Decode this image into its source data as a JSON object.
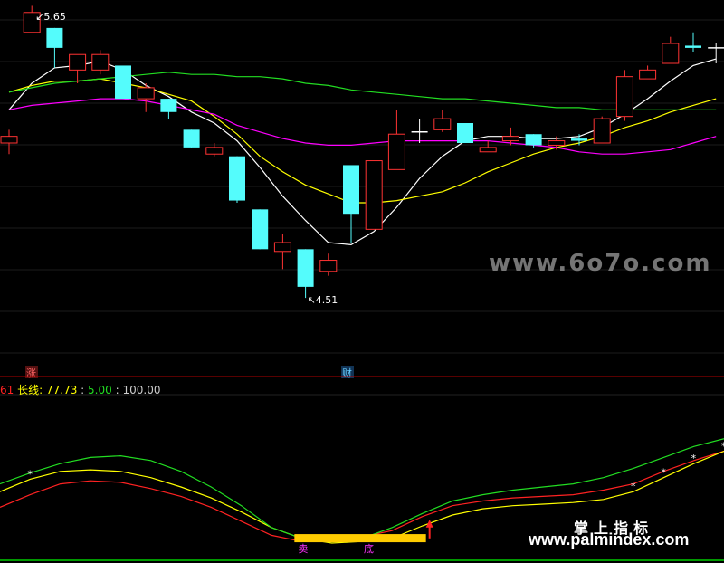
{
  "chart_data": [
    {
      "type": "candlestick",
      "price_range": [
        4.12,
        5.74
      ],
      "candles": [
        {
          "o": 5.11,
          "c": 5.14,
          "h": 5.17,
          "l": 5.06,
          "color": "red"
        },
        {
          "o": 5.61,
          "c": 5.7,
          "h": 5.73,
          "l": 5.61,
          "color": "red"
        },
        {
          "o": 5.63,
          "c": 5.54,
          "h": 5.63,
          "l": 5.45,
          "color": "cyan"
        },
        {
          "o": 5.44,
          "c": 5.51,
          "h": 5.51,
          "l": 5.38,
          "color": "red"
        },
        {
          "o": 5.44,
          "c": 5.51,
          "h": 5.53,
          "l": 5.42,
          "color": "red"
        },
        {
          "o": 5.46,
          "c": 5.31,
          "h": 5.46,
          "l": 5.31,
          "color": "cyan"
        },
        {
          "o": 5.31,
          "c": 5.36,
          "h": 5.38,
          "l": 5.25,
          "color": "red"
        },
        {
          "o": 5.31,
          "c": 5.25,
          "h": 5.31,
          "l": 5.22,
          "color": "cyan"
        },
        {
          "o": 5.17,
          "c": 5.09,
          "h": 5.17,
          "l": 5.09,
          "color": "cyan"
        },
        {
          "o": 5.06,
          "c": 5.09,
          "h": 5.11,
          "l": 5.05,
          "color": "red"
        },
        {
          "o": 5.05,
          "c": 4.85,
          "h": 5.05,
          "l": 4.84,
          "color": "cyan"
        },
        {
          "o": 4.81,
          "c": 4.63,
          "h": 4.81,
          "l": 4.63,
          "color": "cyan"
        },
        {
          "o": 4.62,
          "c": 4.66,
          "h": 4.7,
          "l": 4.54,
          "color": "red"
        },
        {
          "o": 4.63,
          "c": 4.46,
          "h": 4.63,
          "l": 4.41,
          "color": "cyan"
        },
        {
          "o": 4.53,
          "c": 4.58,
          "h": 4.61,
          "l": 4.51,
          "color": "red"
        },
        {
          "o": 5.01,
          "c": 4.79,
          "h": 5.01,
          "l": 4.66,
          "color": "cyan"
        },
        {
          "o": 4.72,
          "c": 5.03,
          "h": 5.03,
          "l": 4.72,
          "color": "red"
        },
        {
          "o": 4.99,
          "c": 5.15,
          "h": 5.26,
          "l": 4.99,
          "color": "red"
        },
        {
          "o": 5.16,
          "c": 5.16,
          "h": 5.22,
          "l": 5.11,
          "color": "white"
        },
        {
          "o": 5.17,
          "c": 5.22,
          "h": 5.26,
          "l": 5.16,
          "color": "red"
        },
        {
          "o": 5.2,
          "c": 5.11,
          "h": 5.2,
          "l": 5.11,
          "color": "cyan"
        },
        {
          "o": 5.07,
          "c": 5.09,
          "h": 5.12,
          "l": 5.07,
          "color": "red"
        },
        {
          "o": 5.12,
          "c": 5.14,
          "h": 5.18,
          "l": 5.1,
          "color": "red"
        },
        {
          "o": 5.15,
          "c": 5.1,
          "h": 5.15,
          "l": 5.09,
          "color": "cyan"
        },
        {
          "o": 5.1,
          "c": 5.12,
          "h": 5.14,
          "l": 5.08,
          "color": "red"
        },
        {
          "o": 5.12,
          "c": 5.13,
          "h": 5.15,
          "l": 5.1,
          "color": "cyan"
        },
        {
          "o": 5.11,
          "c": 5.22,
          "h": 5.23,
          "l": 5.11,
          "color": "red"
        },
        {
          "o": 5.23,
          "c": 5.41,
          "h": 5.44,
          "l": 5.21,
          "color": "red"
        },
        {
          "o": 5.4,
          "c": 5.44,
          "h": 5.46,
          "l": 5.4,
          "color": "red"
        },
        {
          "o": 5.47,
          "c": 5.56,
          "h": 5.59,
          "l": 5.47,
          "color": "red"
        },
        {
          "o": 5.55,
          "c": 5.54,
          "h": 5.61,
          "l": 5.52,
          "color": "cyan"
        },
        {
          "o": 5.54,
          "c": 5.48,
          "h": 5.56,
          "l": 5.47,
          "color": "white"
        }
      ],
      "moving_averages": [
        {
          "color": "#ffffff",
          "values": [
            5.26,
            5.38,
            5.45,
            5.46,
            5.48,
            5.44,
            5.37,
            5.32,
            5.25,
            5.2,
            5.12,
            5.0,
            4.87,
            4.76,
            4.66,
            4.65,
            4.71,
            4.82,
            4.95,
            5.05,
            5.12,
            5.14,
            5.14,
            5.13,
            5.13,
            5.14,
            5.18,
            5.24,
            5.31,
            5.39,
            5.46,
            5.49
          ]
        },
        {
          "color": "#ffff00",
          "values": [
            5.34,
            5.37,
            5.39,
            5.39,
            5.4,
            5.38,
            5.36,
            5.33,
            5.3,
            5.23,
            5.15,
            5.05,
            4.98,
            4.92,
            4.88,
            4.84,
            4.84,
            4.85,
            4.87,
            4.89,
            4.93,
            4.98,
            5.02,
            5.06,
            5.09,
            5.11,
            5.14,
            5.18,
            5.21,
            5.25,
            5.28,
            5.31
          ]
        },
        {
          "color": "#ff00ff",
          "values": [
            5.26,
            5.28,
            5.29,
            5.3,
            5.31,
            5.31,
            5.3,
            5.28,
            5.26,
            5.24,
            5.19,
            5.16,
            5.13,
            5.11,
            5.1,
            5.1,
            5.11,
            5.12,
            5.12,
            5.12,
            5.12,
            5.12,
            5.11,
            5.1,
            5.09,
            5.07,
            5.06,
            5.06,
            5.07,
            5.08,
            5.11,
            5.14
          ]
        },
        {
          "color": "#22dd22",
          "values": [
            5.34,
            5.36,
            5.38,
            5.39,
            5.4,
            5.41,
            5.42,
            5.43,
            5.42,
            5.42,
            5.41,
            5.41,
            5.4,
            5.38,
            5.37,
            5.35,
            5.34,
            5.33,
            5.32,
            5.31,
            5.31,
            5.3,
            5.29,
            5.28,
            5.27,
            5.27,
            5.26,
            5.26,
            5.26,
            5.26,
            5.26,
            5.26
          ]
        }
      ],
      "annotations": {
        "high": "5.65",
        "low": "4.51",
        "marker_up": "涨",
        "marker_finance": "财"
      }
    },
    {
      "type": "line",
      "title": "",
      "legend_prefix": "61",
      "legend_name": "长线:",
      "legend_value": "77.73",
      "legend_sep": ":",
      "legend_v2": "5.00",
      "legend_sep2": ":",
      "legend_v3": "100.00",
      "ylim": [
        0,
        100
      ],
      "series": [
        {
          "color": "#ff2222",
          "values": [
            30,
            38,
            45,
            47,
            46,
            42,
            37,
            30,
            21,
            12,
            8,
            9,
            11,
            15,
            24,
            31,
            34,
            36,
            37,
            38,
            41,
            45,
            53,
            60,
            66
          ]
        },
        {
          "color": "#ffff00",
          "values": [
            40,
            48,
            53,
            54,
            53,
            49,
            43,
            36,
            27,
            17,
            10,
            7,
            8,
            10,
            18,
            25,
            29,
            31,
            32,
            33,
            35,
            40,
            49,
            58,
            66
          ]
        },
        {
          "color": "#22dd22",
          "values": [
            45,
            52,
            58,
            62,
            63,
            60,
            53,
            43,
            31,
            17,
            10,
            8,
            10,
            17,
            26,
            34,
            38,
            41,
            43,
            45,
            49,
            55,
            62,
            69,
            74
          ]
        }
      ],
      "bands": [
        {
          "color": "#ffcc00",
          "from_index": 10,
          "to_index": 14,
          "value": 11
        }
      ],
      "markers": {
        "stars": "*",
        "sell_label": "卖",
        "bottom_label": "底"
      }
    }
  ],
  "watermarks": {
    "top": "www.6o7o.com",
    "cn": "掌上指标",
    "url": "www.palmindex.com"
  },
  "colors": {
    "bg": "#000000",
    "up": "#ff3333",
    "down": "#54fcfc",
    "grid": "#1a1a1a"
  }
}
